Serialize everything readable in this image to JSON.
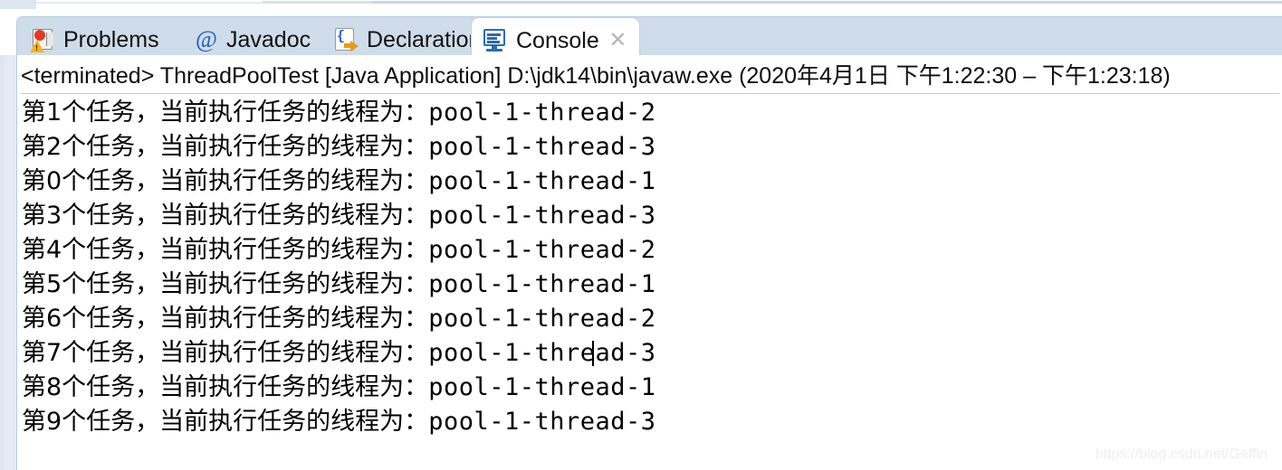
{
  "tabs": [
    {
      "label": "Problems",
      "icon": "problems-icon",
      "active": false
    },
    {
      "label": "Javadoc",
      "icon": "at-sign-icon",
      "active": false
    },
    {
      "label": "Declaration",
      "icon": "declaration-icon",
      "active": false
    },
    {
      "label": "Console",
      "icon": "console-icon",
      "active": true
    }
  ],
  "close_button": {
    "label": "✕",
    "icon": "close-icon"
  },
  "status": {
    "text": "<terminated> ThreadPoolTest [Java Application] D:\\jdk14\\bin\\javaw.exe  (2020年4月1日 下午1:22:30 – 下午1:23:18)",
    "state": "<terminated>",
    "program": "ThreadPoolTest",
    "launch_type": "[Java Application]",
    "vm_path": "D:\\jdk14\\bin\\javaw.exe",
    "date": "2020年4月1日",
    "start_time": "下午1:22:30",
    "end_time": "下午1:23:18"
  },
  "output": {
    "lines": [
      {
        "prefix": "第1个任务，当前执行任务的线程为：",
        "thread": "pool-1-thread-2"
      },
      {
        "prefix": "第2个任务，当前执行任务的线程为：",
        "thread": "pool-1-thread-3"
      },
      {
        "prefix": "第0个任务，当前执行任务的线程为：",
        "thread": "pool-1-thread-1"
      },
      {
        "prefix": "第3个任务，当前执行任务的线程为：",
        "thread": "pool-1-thread-3"
      },
      {
        "prefix": "第4个任务，当前执行任务的线程为：",
        "thread": "pool-1-thread-2"
      },
      {
        "prefix": "第5个任务，当前执行任务的线程为：",
        "thread": "pool-1-thread-1"
      },
      {
        "prefix": "第6个任务，当前执行任务的线程为：",
        "thread": "pool-1-thread-2"
      },
      {
        "prefix": "第7个任务，当前执行任务的线程为：",
        "thread": "pool-1-thread-3"
      },
      {
        "prefix": "第8个任务，当前执行任务的线程为：",
        "thread": "pool-1-thread-1"
      },
      {
        "prefix": "第9个任务，当前执行任务的线程为：",
        "thread": "pool-1-thread-3"
      }
    ],
    "caret_line_index": 7
  },
  "watermark": {
    "text": "https://blog.csdn.net/Geffin"
  },
  "colors": {
    "tabbar_background": "#cfdce9",
    "active_tab_background": "#ffffff",
    "console_background": "#ffffff",
    "text": "#000000",
    "javadoc_icon": "#1c5fbe",
    "console_icon": "#2d6ca8",
    "error_marker": "#e03a28",
    "warning_marker": "#f2b61f",
    "declaration_arrow": "#e59a1c",
    "gutter": "#e3eaf4"
  }
}
